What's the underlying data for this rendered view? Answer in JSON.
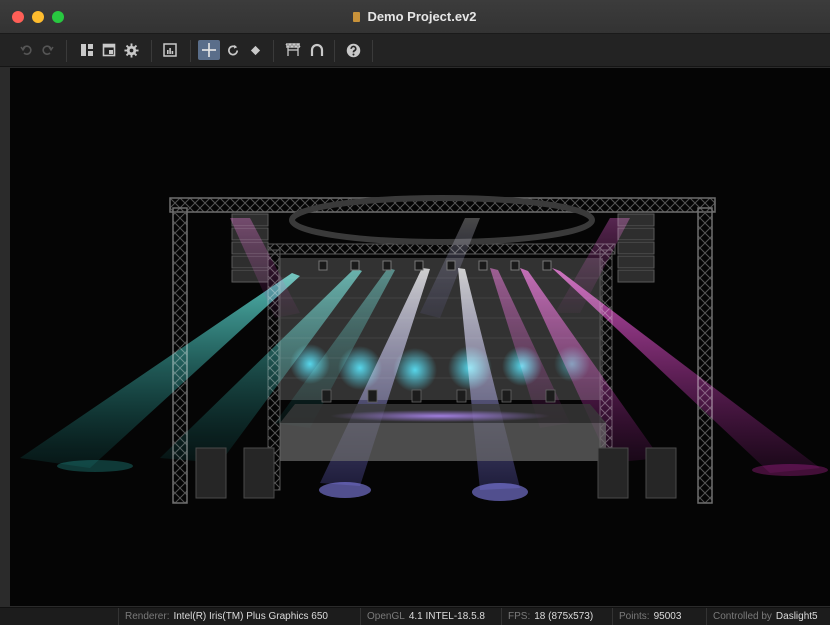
{
  "window": {
    "title": "Demo Project.ev2"
  },
  "toolbar": {
    "buttons": [
      {
        "name": "undo",
        "icon": "undo-icon",
        "enabled": false
      },
      {
        "name": "redo",
        "icon": "redo-icon",
        "enabled": false
      },
      {
        "name": "layout",
        "icon": "layout-icon",
        "enabled": true
      },
      {
        "name": "window",
        "icon": "window-icon",
        "enabled": true
      },
      {
        "name": "settings",
        "icon": "gear-icon",
        "enabled": true
      },
      {
        "name": "stats",
        "icon": "chart-icon",
        "enabled": true
      },
      {
        "name": "move",
        "icon": "move-icon",
        "enabled": true,
        "active": true
      },
      {
        "name": "rotate",
        "icon": "rotate-icon",
        "enabled": true
      },
      {
        "name": "focus",
        "icon": "diamond-icon",
        "enabled": true
      },
      {
        "name": "truss",
        "icon": "truss-icon",
        "enabled": true
      },
      {
        "name": "magnet",
        "icon": "magnet-icon",
        "enabled": true
      },
      {
        "name": "help",
        "icon": "help-icon",
        "enabled": true
      }
    ]
  },
  "status": {
    "renderer_label": "Renderer:",
    "renderer_value": "Intel(R) Iris(TM) Plus Graphics 650",
    "opengl_label": "OpenGL",
    "opengl_value": "4.1 INTEL-18.5.8",
    "fps_label": "FPS:",
    "fps_value": "18 (875x573)",
    "points_label": "Points:",
    "points_value": "95003",
    "controlled_label": "Controlled by",
    "controlled_value": "Daslight5"
  },
  "colors": {
    "accent_active": "#5a6e8a",
    "beam_cyan": "#2fd6d0",
    "beam_lavender": "#b0a8ff",
    "beam_magenta": "#ff2fd2"
  }
}
